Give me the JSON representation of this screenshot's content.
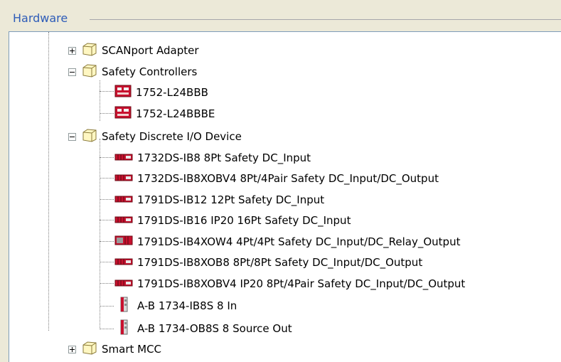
{
  "panel": {
    "title": "Hardware"
  },
  "tree": {
    "nodes": [
      {
        "label": "SCANport Adapter",
        "icon": "folder-icon",
        "expanded": false
      },
      {
        "label": "Safety Controllers",
        "icon": "folder-icon",
        "expanded": true,
        "children": [
          {
            "label": "1752-L24BBB",
            "icon": "safety-controller-icon"
          },
          {
            "label": "1752-L24BBBE",
            "icon": "safety-controller-icon"
          }
        ]
      },
      {
        "label": "Safety Discrete I/O Device",
        "icon": "folder-icon",
        "expanded": true,
        "children": [
          {
            "label": "1732DS-IB8 8Pt Safety DC_Input",
            "icon": "io-module-icon"
          },
          {
            "label": "1732DS-IB8XOBV4 8Pt/4Pair Safety DC_Input/DC_Output",
            "icon": "io-module-icon"
          },
          {
            "label": "1791DS-IB12 12Pt Safety DC_Input",
            "icon": "io-module-icon"
          },
          {
            "label": "1791DS-IB16 IP20 16Pt Safety DC_Input",
            "icon": "io-module-icon"
          },
          {
            "label": "1791DS-IB4XOW4 4Pt/4Pt Safety DC_Input/DC_Relay_Output",
            "icon": "io-module-icon"
          },
          {
            "label": "1791DS-IB8XOB8 8Pt/8Pt Safety DC_Input/DC_Output",
            "icon": "io-module-icon"
          },
          {
            "label": "1791DS-IB8XOBV4 IP20 8Pt/4Pair Safety DC_Input/DC_Output",
            "icon": "io-module-icon"
          },
          {
            "label": "A-B 1734-IB8S 8 In",
            "icon": "point-io-module-icon"
          },
          {
            "label": "A-B 1734-OB8S 8 Source Out",
            "icon": "point-io-module-icon"
          }
        ]
      },
      {
        "label": "Smart MCC",
        "icon": "folder-icon",
        "expanded": false
      }
    ]
  },
  "colors": {
    "panel_title": "#2e5cb8",
    "module_red": "#c8102e",
    "folder_fill": "#fff7c2",
    "folder_stroke": "#8a7a3a",
    "tree_guides": "#808080"
  }
}
